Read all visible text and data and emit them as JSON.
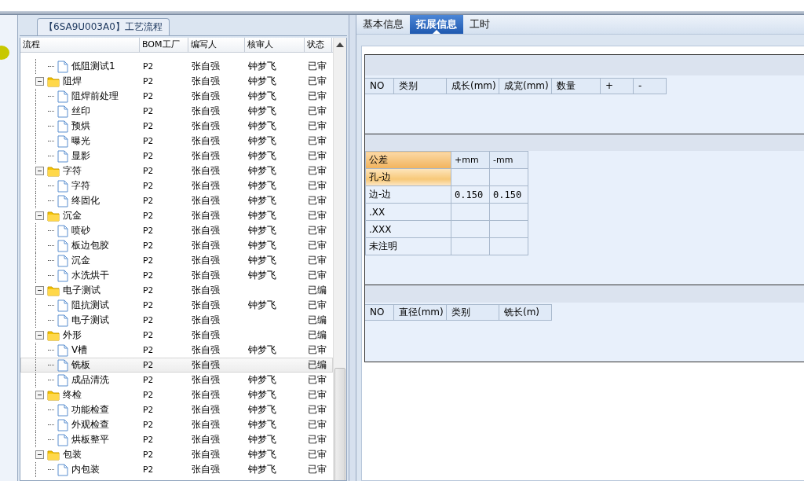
{
  "process_panel": {
    "title": "【6SA9U003A0】工艺流程",
    "columns": [
      "流程",
      "BOM工厂",
      "编写人",
      "核审人",
      "状态"
    ],
    "tree": [
      {
        "label": "低阻测试1",
        "bom": "P2",
        "author": "张自强",
        "reviewer": "钟梦飞",
        "status": "已审",
        "selected": false
      },
      {
        "label": "阻焊",
        "bom": "P2",
        "author": "张自强",
        "reviewer": "钟梦飞",
        "status": "已审",
        "selected": false,
        "expanded": true,
        "children": [
          {
            "label": "阻焊前处理",
            "bom": "P2",
            "author": "张自强",
            "reviewer": "钟梦飞",
            "status": "已审",
            "selected": false
          },
          {
            "label": "丝印",
            "bom": "P2",
            "author": "张自强",
            "reviewer": "钟梦飞",
            "status": "已审",
            "selected": false
          },
          {
            "label": "预烘",
            "bom": "P2",
            "author": "张自强",
            "reviewer": "钟梦飞",
            "status": "已审",
            "selected": false
          },
          {
            "label": "曝光",
            "bom": "P2",
            "author": "张自强",
            "reviewer": "钟梦飞",
            "status": "已审",
            "selected": false
          },
          {
            "label": "显影",
            "bom": "P2",
            "author": "张自强",
            "reviewer": "钟梦飞",
            "status": "已审",
            "selected": false
          }
        ]
      },
      {
        "label": "字符",
        "bom": "P2",
        "author": "张自强",
        "reviewer": "钟梦飞",
        "status": "已审",
        "selected": false,
        "expanded": true,
        "children": [
          {
            "label": "字符",
            "bom": "P2",
            "author": "张自强",
            "reviewer": "钟梦飞",
            "status": "已审",
            "selected": false
          },
          {
            "label": "终固化",
            "bom": "P2",
            "author": "张自强",
            "reviewer": "钟梦飞",
            "status": "已审",
            "selected": false
          }
        ]
      },
      {
        "label": "沉金",
        "bom": "P2",
        "author": "张自强",
        "reviewer": "钟梦飞",
        "status": "已审",
        "selected": false,
        "expanded": true,
        "children": [
          {
            "label": "喷砂",
            "bom": "P2",
            "author": "张自强",
            "reviewer": "钟梦飞",
            "status": "已审",
            "selected": false
          },
          {
            "label": "板边包胶",
            "bom": "P2",
            "author": "张自强",
            "reviewer": "钟梦飞",
            "status": "已审",
            "selected": false
          },
          {
            "label": "沉金",
            "bom": "P2",
            "author": "张自强",
            "reviewer": "钟梦飞",
            "status": "已审",
            "selected": false
          },
          {
            "label": "水洗烘干",
            "bom": "P2",
            "author": "张自强",
            "reviewer": "钟梦飞",
            "status": "已审",
            "selected": false
          }
        ]
      },
      {
        "label": "电子测试",
        "bom": "P2",
        "author": "张自强",
        "status": "已编",
        "selected": false,
        "expanded": true,
        "children": [
          {
            "label": "阻抗测试",
            "bom": "P2",
            "author": "张自强",
            "reviewer": "钟梦飞",
            "status": "已审",
            "selected": false
          },
          {
            "label": "电子测试",
            "bom": "P2",
            "author": "张自强",
            "status": "已编",
            "selected": false
          }
        ]
      },
      {
        "label": "外形",
        "bom": "P2",
        "author": "张自强",
        "status": "已编",
        "selected": false,
        "expanded": true,
        "children": [
          {
            "label": "V槽",
            "bom": "P2",
            "author": "张自强",
            "reviewer": "钟梦飞",
            "status": "已审",
            "selected": false
          },
          {
            "label": "铣板",
            "bom": "P2",
            "author": "张自强",
            "status": "已编",
            "selected": true
          },
          {
            "label": "成品清洗",
            "bom": "P2",
            "author": "张自强",
            "reviewer": "钟梦飞",
            "status": "已审",
            "selected": false
          }
        ]
      },
      {
        "label": "终检",
        "bom": "P2",
        "author": "张自强",
        "reviewer": "钟梦飞",
        "status": "已审",
        "selected": false,
        "expanded": true,
        "children": [
          {
            "label": "功能检查",
            "bom": "P2",
            "author": "张自强",
            "reviewer": "钟梦飞",
            "status": "已审",
            "selected": false
          },
          {
            "label": "外观检查",
            "bom": "P2",
            "author": "张自强",
            "reviewer": "钟梦飞",
            "status": "已审",
            "selected": false
          },
          {
            "label": "烘板整平",
            "bom": "P2",
            "author": "张自强",
            "reviewer": "钟梦飞",
            "status": "已审",
            "selected": false
          }
        ]
      },
      {
        "label": "包装",
        "bom": "P2",
        "author": "张自强",
        "reviewer": "钟梦飞",
        "status": "已审",
        "selected": false,
        "expanded": true,
        "children": [
          {
            "label": "内包装",
            "bom": "P2",
            "author": "张自强",
            "reviewer": "钟梦飞",
            "status": "已审",
            "selected": false
          }
        ]
      }
    ]
  },
  "detail_panel": {
    "tabs": [
      {
        "label": "基本信息",
        "selected": false
      },
      {
        "label": "拓展信息",
        "selected": true
      },
      {
        "label": "工时",
        "selected": false
      }
    ],
    "size_table": {
      "columns": [
        "NO",
        "类别",
        "成长(mm)",
        "成宽(mm)",
        "数量",
        "+",
        "-"
      ]
    },
    "tolerance_table": {
      "columns": [
        "公差",
        "+mm",
        "-mm"
      ],
      "rows": [
        {
          "label": "孔-边",
          "selected": true
        },
        {
          "label": "边-边",
          "plus": "0.150",
          "minus": "0.150",
          "selected": false
        },
        {
          "label": ".XX",
          "selected": false
        },
        {
          "label": ".XXX",
          "selected": false
        },
        {
          "label": "未注明",
          "selected": false
        }
      ]
    },
    "drill_table": {
      "columns": [
        "NO",
        "直径(mm)",
        "类别",
        "铣长(m)"
      ]
    }
  }
}
